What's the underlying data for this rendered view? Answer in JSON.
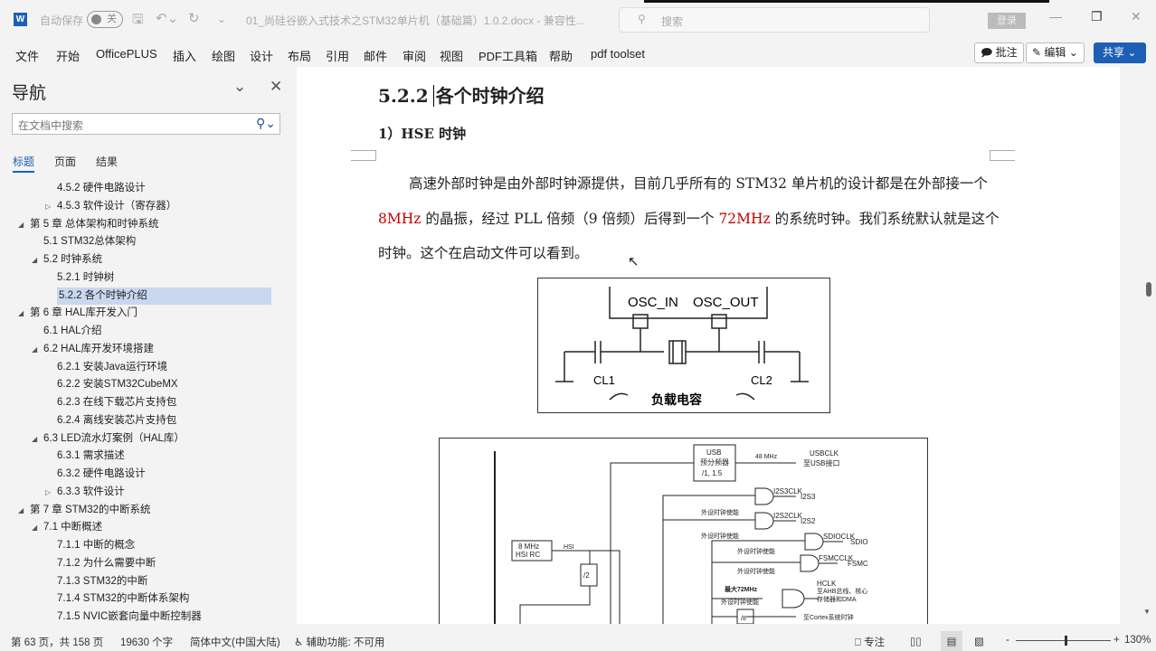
{
  "titlebar": {
    "app_icon": "word-icon",
    "autosave_label": "自动保存",
    "autosave_state": "关",
    "doc_title": "01_尚硅谷嵌入式技术之STM32单片机（基础篇）1.0.2.docx - 兼容性...",
    "search_placeholder": "搜索",
    "login": "登录"
  },
  "menu": [
    "文件",
    "开始",
    "OfficePLUS",
    "插入",
    "绘图",
    "设计",
    "布局",
    "引用",
    "邮件",
    "审阅",
    "视图",
    "PDF工具箱",
    "帮助",
    "pdf toolset"
  ],
  "ribbon_right": {
    "comment": "批注",
    "edit": "编辑",
    "share": "共享"
  },
  "nav": {
    "title": "导航",
    "search_placeholder": "在文档中搜索",
    "tabs": [
      "标题",
      "页面",
      "结果"
    ],
    "items": [
      {
        "label": "4.5.2 硬件电路设计",
        "level": 2,
        "toggle": ""
      },
      {
        "label": "4.5.3 软件设计（寄存器）",
        "level": 2,
        "toggle": "collapsed"
      },
      {
        "label": "第 5 章 总体架构和时钟系统",
        "level": 0,
        "toggle": "expanded"
      },
      {
        "label": "5.1 STM32总体架构",
        "level": 1,
        "toggle": ""
      },
      {
        "label": "5.2 时钟系统",
        "level": 1,
        "toggle": "expanded"
      },
      {
        "label": "5.2.1 时钟树",
        "level": 2,
        "toggle": ""
      },
      {
        "label": "5.2.2 各个时钟介绍",
        "level": 2,
        "toggle": "",
        "selected": true
      },
      {
        "label": "第 6 章 HAL库开发入门",
        "level": 0,
        "toggle": "expanded"
      },
      {
        "label": "6.1 HAL介绍",
        "level": 1,
        "toggle": ""
      },
      {
        "label": "6.2 HAL库开发环境搭建",
        "level": 1,
        "toggle": "expanded"
      },
      {
        "label": "6.2.1 安装Java运行环境",
        "level": 2,
        "toggle": ""
      },
      {
        "label": "6.2.2 安装STM32CubeMX",
        "level": 2,
        "toggle": ""
      },
      {
        "label": "6.2.3 在线下载芯片支持包",
        "level": 2,
        "toggle": ""
      },
      {
        "label": "6.2.4 离线安装芯片支持包",
        "level": 2,
        "toggle": ""
      },
      {
        "label": "6.3 LED流水灯案例（HAL库）",
        "level": 1,
        "toggle": "expanded"
      },
      {
        "label": "6.3.1 需求描述",
        "level": 2,
        "toggle": ""
      },
      {
        "label": "6.3.2 硬件电路设计",
        "level": 2,
        "toggle": ""
      },
      {
        "label": "6.3.3 软件设计",
        "level": 2,
        "toggle": "collapsed"
      },
      {
        "label": "第 7 章 STM32的中断系统",
        "level": 0,
        "toggle": "expanded"
      },
      {
        "label": "7.1 中断概述",
        "level": 1,
        "toggle": "expanded"
      },
      {
        "label": "7.1.1 中断的概念",
        "level": 2,
        "toggle": ""
      },
      {
        "label": "7.1.2 为什么需要中断",
        "level": 2,
        "toggle": ""
      },
      {
        "label": "7.1.3 STM32的中断",
        "level": 2,
        "toggle": ""
      },
      {
        "label": "7.1.4 STM32的中断体系架构",
        "level": 2,
        "toggle": ""
      },
      {
        "label": "7.1.5 NVIC嵌套向量中断控制器",
        "level": 2,
        "toggle": ""
      }
    ]
  },
  "doc": {
    "heading": "5.2.2",
    "heading_text": "各个时钟介绍",
    "subheading": "1）HSE 时钟",
    "para": [
      "高速外部时钟是由外部时钟源提供，目前几乎所有的 STM32 单片机的设计都是在外部接一个 ",
      "8MHz",
      " 的晶振，经过 PLL 倍频（9 倍频）后得到一个 ",
      "72MHz",
      " 的系统时钟。我们系统默认就是这个时钟。这个在启动文件可以看到。"
    ],
    "accent_color": "#c00000",
    "fig1": {
      "osc_in": "OSC_IN",
      "osc_out": "OSC_OUT",
      "cl1": "CL1",
      "cl2": "CL2",
      "caption": "负载电容"
    },
    "fig2": {
      "usb_box": [
        "USB",
        "预分频器",
        "/1, 1.5"
      ],
      "usb_freq": "48 MHz",
      "usbclk": "USBCLK",
      "usb_dest": "至USB接口",
      "i2s3clk": "I2S3CLK",
      "i2s3": "I2S3",
      "i2s2clk": "I2S2CLK",
      "i2s2": "I2S2",
      "enable": "外设时钟使能",
      "sdioclk": "SDIOCLK",
      "sdio": "SDIO",
      "fsmcclk": "FSMCCLK",
      "fsmc": "FSMC",
      "hsi_box": [
        "8 MHz",
        "HSI RC"
      ],
      "hsi": "HSI",
      "div2": "/2",
      "max": "最大72MHz",
      "hclk": "HCLK",
      "hclk_dest1": "至AHB总线、核心",
      "hclk_dest2": "存储器和DMA",
      "div8": "/8",
      "cortex": "至Cortex系统时钟"
    }
  },
  "status": {
    "page": "第 63 页，共 158 页",
    "words": "19630 个字",
    "lang": "简体中文(中国大陆)",
    "access": "辅助功能: 不可用",
    "focus": "专注",
    "zoom": "130%",
    "zoom_value": 130
  }
}
